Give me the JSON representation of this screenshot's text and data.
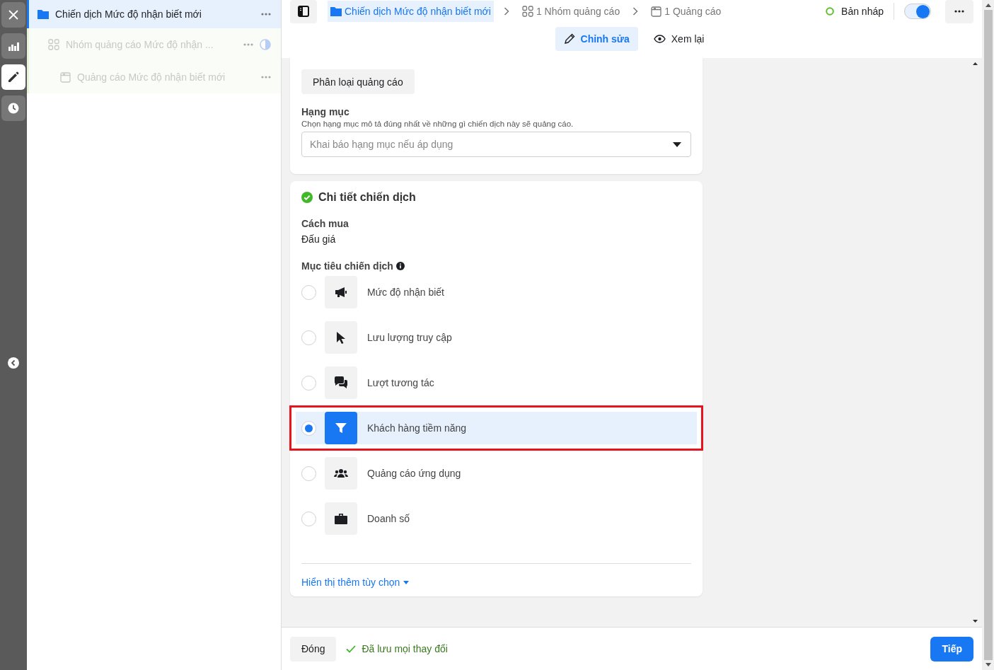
{
  "tree": [
    {
      "kind": "campaign",
      "label": "Chiến dịch Mức độ nhận biết mới",
      "selected": true,
      "children": [
        {
          "kind": "adset",
          "label": "Nhóm quảng cáo Mức độ nhận ...",
          "selected": false,
          "children": [
            {
              "kind": "ad",
              "label": "Quảng cáo Mức độ nhận biết mới",
              "selected": false
            }
          ]
        }
      ]
    }
  ],
  "rail": [
    {
      "kind": "close",
      "selected": false
    },
    {
      "kind": "chart",
      "selected": false
    },
    {
      "kind": "edit",
      "selected": true
    },
    {
      "kind": "clock",
      "selected": false
    }
  ],
  "breadcrumb": [
    {
      "kind": "campaign",
      "label": "Chiến dịch Mức độ nhận biết mới",
      "selected": true
    },
    {
      "kind": "adset",
      "label": "1 Nhóm quảng cáo",
      "selected": false
    },
    {
      "kind": "ad",
      "label": "1 Quảng cáo",
      "selected": false
    }
  ],
  "status": {
    "label": "Bản nháp",
    "on": true
  },
  "modes": [
    {
      "kind": "edit",
      "label": "Chỉnh sửa",
      "selected": true
    },
    {
      "kind": "review",
      "label": "Xem lại",
      "selected": false
    }
  ],
  "category_card": {
    "button": "Phân loại quảng cáo",
    "title": "Hạng mục",
    "hint": "Chọn hạng mục mô tả đúng nhất về những gì chiến dịch này sẽ quảng cáo.",
    "placeholder": "Khai báo hạng mục nếu áp dụng"
  },
  "details_card": {
    "title": "Chi tiết chiến dịch",
    "buying_label": "Cách mua",
    "buying_value": "Đấu giá",
    "objective_label": "Mục tiêu chiến dịch",
    "objectives": [
      {
        "kind": "megaphone",
        "label": "Mức độ nhận biết",
        "selected": false
      },
      {
        "kind": "cursor",
        "label": "Lưu lượng truy cập",
        "selected": false
      },
      {
        "kind": "chat",
        "label": "Lượt tương tác",
        "selected": false
      },
      {
        "kind": "funnel",
        "label": "Khách hàng tiềm năng",
        "selected": true
      },
      {
        "kind": "people",
        "label": "Quảng cáo ứng dụng",
        "selected": false
      },
      {
        "kind": "bag",
        "label": "Doanh số",
        "selected": false
      }
    ],
    "more_link": "Hiển thị thêm tùy chọn"
  },
  "footer": {
    "close": "Đóng",
    "saved": "Đã lưu mọi thay đổi",
    "next": "Tiếp"
  }
}
